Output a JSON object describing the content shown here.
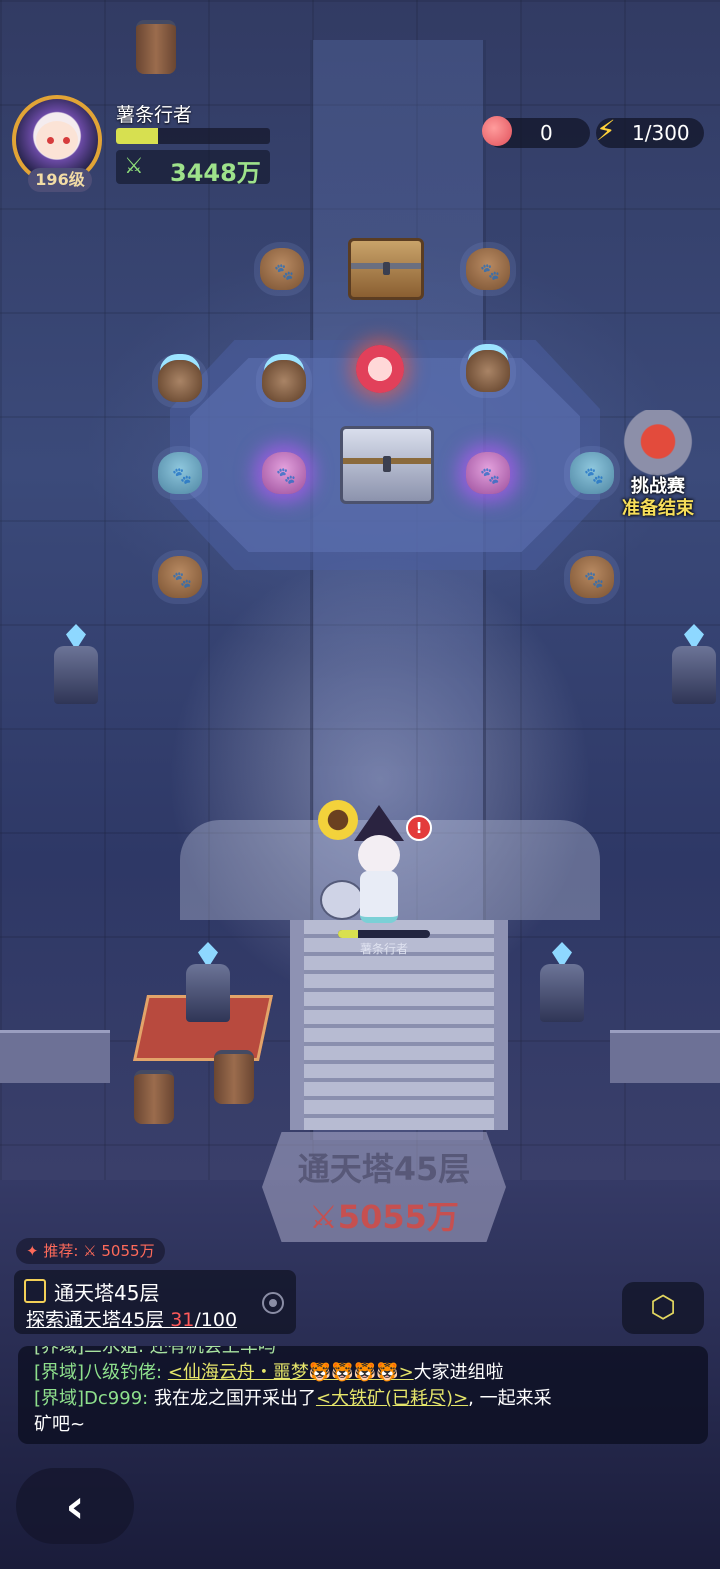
{
  "player": {
    "name": "薯条行者",
    "level": "196级",
    "xp_fraction": 0.27,
    "power": "3448万"
  },
  "resources": {
    "peach": "0",
    "energy": "1/300"
  },
  "challenge": {
    "title": "挑战赛",
    "status": "准备结束"
  },
  "hero": {
    "name": "薯条行者",
    "alert": "!",
    "hp_fraction": 0.22
  },
  "floor_sign": {
    "title": "通天塔45层",
    "power": "5055万"
  },
  "recommend": {
    "label": "✦ 推荐: ",
    "power": "5055万"
  },
  "quest": {
    "title": "通天塔45层",
    "desc_prefix": "探索通天塔45层 ",
    "progress_current": "31",
    "progress_total": "/100"
  },
  "chat": {
    "line0": "[界域]三水姐: 还有机会上车吗",
    "line1_channel": "[界域]八级钓佬: ",
    "line1_link": "<仙海云舟・噩梦🐯🐯🐯🐯>",
    "line1_tail": "大家进组啦",
    "line2_channel": "[界域]Dc999: ",
    "line2_text": "我在龙之国开采出了",
    "line2_link": "<大铁矿(已耗尽)>",
    "line2_tail": ", 一起来采",
    "line3_text": "矿吧~"
  },
  "icons": {
    "back": "chevron-left-icon",
    "box": "cube-icon",
    "locate": "locate-icon",
    "energy": "lightning-icon",
    "peach": "peach-icon",
    "power": "crossed-weapons-icon"
  }
}
